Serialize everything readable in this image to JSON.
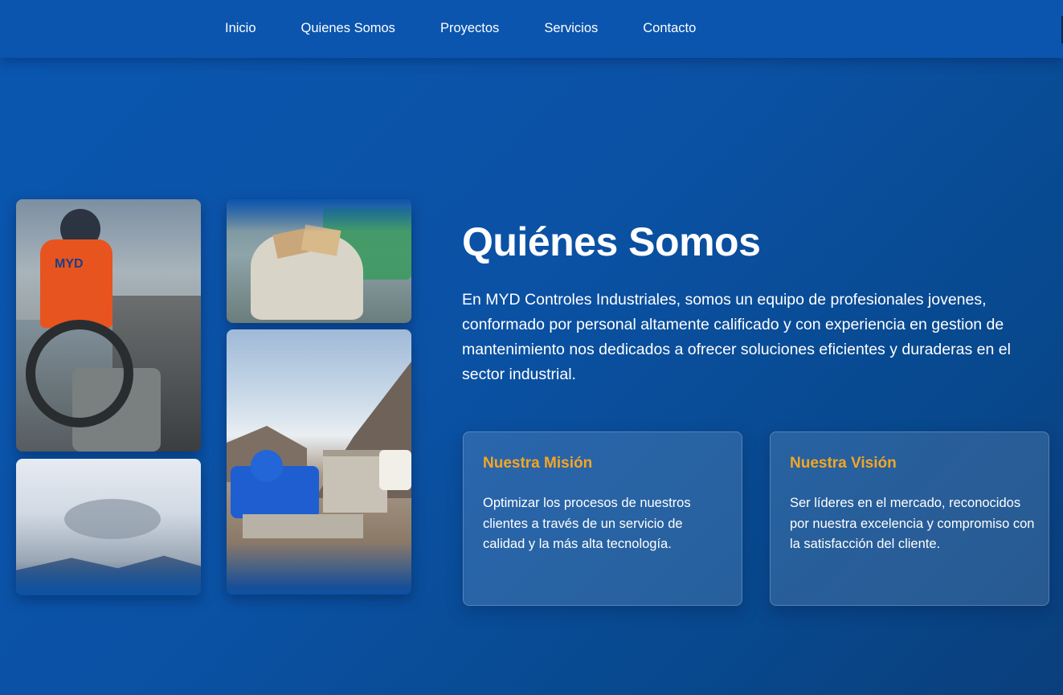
{
  "nav": {
    "items": [
      {
        "label": "Inicio"
      },
      {
        "label": "Quienes Somos"
      },
      {
        "label": "Proyectos"
      },
      {
        "label": "Servicios"
      },
      {
        "label": "Contacto"
      }
    ]
  },
  "gallery": {
    "photo1": {
      "vest_text": "MYD"
    }
  },
  "about": {
    "title": "Quiénes Somos",
    "description": "En MYD Controles Industriales, somos un equipo de profesionales jovenes, conformado por personal altamente calificado y con experiencia en gestion de mantenimiento nos dedicados a ofrecer soluciones eficientes y duraderas en el sector industrial."
  },
  "cards": {
    "mision": {
      "title": "Nuestra Misión",
      "text": "Optimizar los procesos de nuestros clientes a través de un servicio de calidad y la más alta tecnología."
    },
    "vision": {
      "title": "Nuestra Visión",
      "text": "Ser líderes en el mercado, reconocidos por nuestra excelencia y compromiso con la satisfacción del cliente."
    }
  },
  "colors": {
    "accent": "#f5a623",
    "nav_bg": "#0b55ae",
    "page_bg": "#0b52a5"
  }
}
